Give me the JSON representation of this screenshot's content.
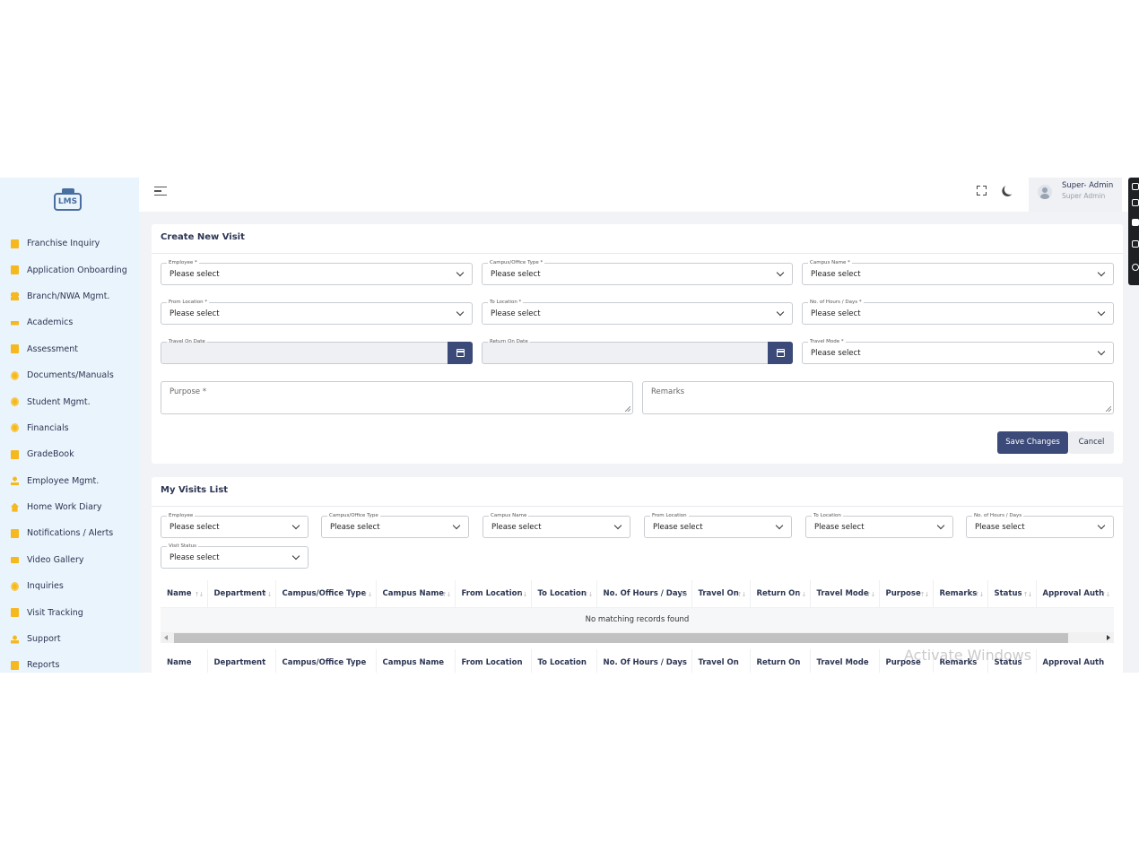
{
  "app": {
    "logo_text": "LMS"
  },
  "sidebar": {
    "items": [
      {
        "label": "Franchise Inquiry",
        "icon": "document-icon"
      },
      {
        "label": "Application Onboarding",
        "icon": "document-icon"
      },
      {
        "label": "Branch/NWA Mgmt.",
        "icon": "people-icon"
      },
      {
        "label": "Academics",
        "icon": "graduation-cap-icon"
      },
      {
        "label": "Assessment",
        "icon": "document-icon"
      },
      {
        "label": "Documents/Manuals",
        "icon": "gear-icon"
      },
      {
        "label": "Student Mgmt.",
        "icon": "gear-icon"
      },
      {
        "label": "Financials",
        "icon": "gear-icon"
      },
      {
        "label": "GradeBook",
        "icon": "book-icon"
      },
      {
        "label": "Employee Mgmt.",
        "icon": "person-icon"
      },
      {
        "label": "Home Work Diary",
        "icon": "home-icon"
      },
      {
        "label": "Notifications / Alerts",
        "icon": "document-icon"
      },
      {
        "label": "Video Gallery",
        "icon": "video-icon"
      },
      {
        "label": "Inquiries",
        "icon": "gear-icon"
      },
      {
        "label": "Visit Tracking",
        "icon": "document-icon"
      },
      {
        "label": "Support",
        "icon": "support-icon"
      },
      {
        "label": "Reports",
        "icon": "folder-icon"
      }
    ]
  },
  "header": {
    "user_name": "Super- Admin",
    "user_role": "Super Admin"
  },
  "create_visit": {
    "title": "Create New Visit",
    "fields": {
      "employee": {
        "label": "Employee *",
        "value": "Please select"
      },
      "campus_type": {
        "label": "Campus/Office Type *",
        "value": "Please select"
      },
      "campus_name": {
        "label": "Campus Name *",
        "value": "Please select"
      },
      "from_location": {
        "label": "From Location *",
        "value": "Please select"
      },
      "to_location": {
        "label": "To Location *",
        "value": "Please select"
      },
      "hours_days": {
        "label": "No. of Hours / Days *",
        "value": "Please select"
      },
      "travel_on": {
        "label": "Travel On Date",
        "value": ""
      },
      "return_on": {
        "label": "Return On Date",
        "value": ""
      },
      "travel_mode": {
        "label": "Travel Mode *",
        "value": "Please select"
      }
    },
    "purpose_placeholder": "Purpose *",
    "remarks_placeholder": "Remarks",
    "save_label": "Save Changes",
    "cancel_label": "Cancel"
  },
  "visits_list": {
    "title": "My Visits List",
    "filters": {
      "employee": {
        "label": "Employee",
        "value": "Please select"
      },
      "campus_type": {
        "label": "Campus/Office Type",
        "value": "Please select"
      },
      "campus_name": {
        "label": "Campus Name",
        "value": "Please select"
      },
      "from_location": {
        "label": "From Location",
        "value": "Please select"
      },
      "to_location": {
        "label": "To Location",
        "value": "Please select"
      },
      "hours_days": {
        "label": "No. of Hours / Days",
        "value": "Please select"
      },
      "visit_status": {
        "label": "Visit Status",
        "value": "Please select"
      }
    },
    "columns": [
      "Name",
      "Department",
      "Campus/Office Type",
      "Campus Name",
      "From Location",
      "To Location",
      "No. Of Hours / Days",
      "Travel On",
      "Return On",
      "Travel Mode",
      "Purpose",
      "Remarks",
      "Status",
      "Approval Auth"
    ],
    "empty_message": "No matching records found"
  },
  "watermark": "Activate Windows"
}
